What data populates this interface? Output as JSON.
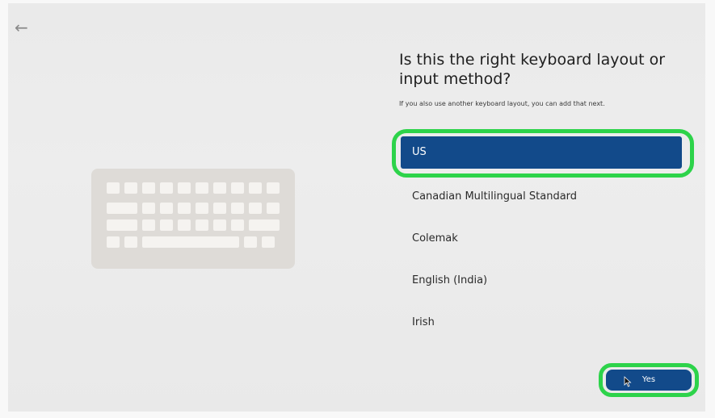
{
  "nav": {
    "back_icon": "back-arrow-icon",
    "back_glyph": "←"
  },
  "illustration": {
    "icon": "keyboard-icon"
  },
  "page": {
    "heading": "Is this the right keyboard layout or input method?",
    "subtext": "If you also use another keyboard layout, you can add that next."
  },
  "layouts": [
    {
      "label": "US",
      "selected": true
    },
    {
      "label": "Canadian Multilingual Standard",
      "selected": false
    },
    {
      "label": "Colemak",
      "selected": false
    },
    {
      "label": "English (India)",
      "selected": false
    },
    {
      "label": "Irish",
      "selected": false
    }
  ],
  "actions": {
    "yes_label": "Yes"
  },
  "colors": {
    "accent": "#124a8a",
    "highlight": "#2dd34a",
    "background": "#ececec"
  }
}
